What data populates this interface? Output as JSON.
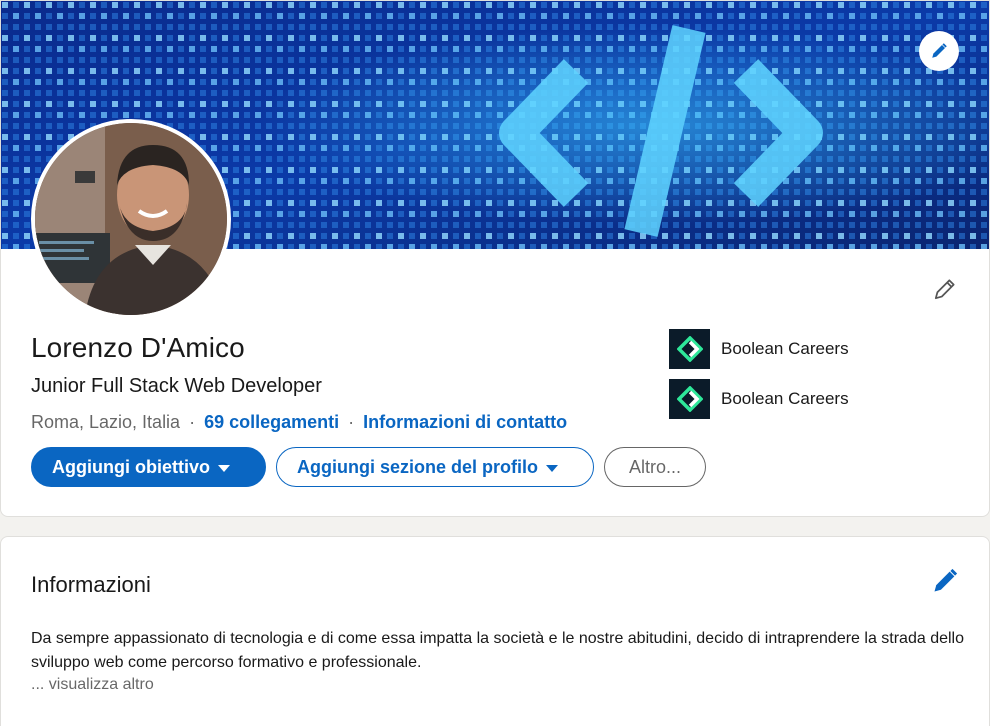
{
  "profile": {
    "name": "Lorenzo D'Amico",
    "headline": "Junior Full Stack Web Developer",
    "location": "Roma, Lazio, Italia",
    "separator": "·",
    "connections": "69 collegamenti",
    "contact_info": "Informazioni di contatto",
    "actions": {
      "primary": "Aggiungi obiettivo",
      "secondary": "Aggiungi sezione del profilo",
      "more": "Altro..."
    },
    "companies": [
      {
        "name": "Boolean Careers",
        "logo_icon": "boolean-logo-icon"
      },
      {
        "name": "Boolean Careers",
        "logo_icon": "boolean-logo-icon"
      }
    ]
  },
  "about": {
    "title": "Informazioni",
    "text": "Da sempre appassionato di tecnologia e di come essa impatta la società e le nostre abitudini, decido di intraprendere la strada dello sviluppo web come percorso formativo e professionale.",
    "ellipsis": "...",
    "see_more": "visualizza altro"
  },
  "icons": {
    "edit_banner": "pencil-icon",
    "edit_intro": "pencil-icon",
    "edit_about": "pencil-icon"
  },
  "colors": {
    "brand": "#0a66c2",
    "banner": "#0b2a7a",
    "page_bg": "#f3f2ef"
  }
}
